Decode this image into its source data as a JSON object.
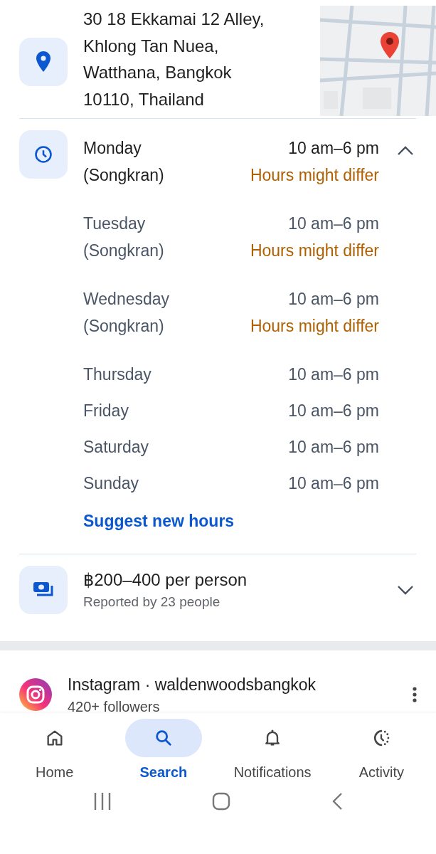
{
  "address": {
    "lines": [
      "30 18 Ekkamai 12 Alley,",
      "Khlong Tan Nuea,",
      "Watthana, Bangkok",
      "10110, Thailand"
    ]
  },
  "hours": {
    "expanded": true,
    "days": [
      {
        "day": "Monday",
        "holiday": "(Songkran)",
        "time": "10 am–6 pm",
        "note": "Hours might differ",
        "today": true
      },
      {
        "day": "Tuesday",
        "holiday": "(Songkran)",
        "time": "10 am–6 pm",
        "note": "Hours might differ",
        "today": false
      },
      {
        "day": "Wednesday",
        "holiday": "(Songkran)",
        "time": "10 am–6 pm",
        "note": "Hours might differ",
        "today": false
      },
      {
        "day": "Thursday",
        "time": "10 am–6 pm",
        "today": false
      },
      {
        "day": "Friday",
        "time": "10 am–6 pm",
        "today": false
      },
      {
        "day": "Saturday",
        "time": "10 am–6 pm",
        "today": false
      },
      {
        "day": "Sunday",
        "time": "10 am–6 pm",
        "today": false
      }
    ],
    "suggest_link": "Suggest new hours"
  },
  "price": {
    "range": "฿200–400 per person",
    "reported": "Reported by 23 people",
    "expanded": false
  },
  "social": {
    "source": "Instagram",
    "separator": "·",
    "handle": "waldenwoodsbangkok",
    "followers": "420+ followers"
  },
  "bottom_nav": [
    {
      "label": "Home",
      "kind": "home",
      "selected": false
    },
    {
      "label": "Search",
      "kind": "search",
      "selected": true
    },
    {
      "label": "Notifications",
      "kind": "bell",
      "selected": false
    },
    {
      "label": "Activity",
      "kind": "activity",
      "selected": false
    }
  ]
}
